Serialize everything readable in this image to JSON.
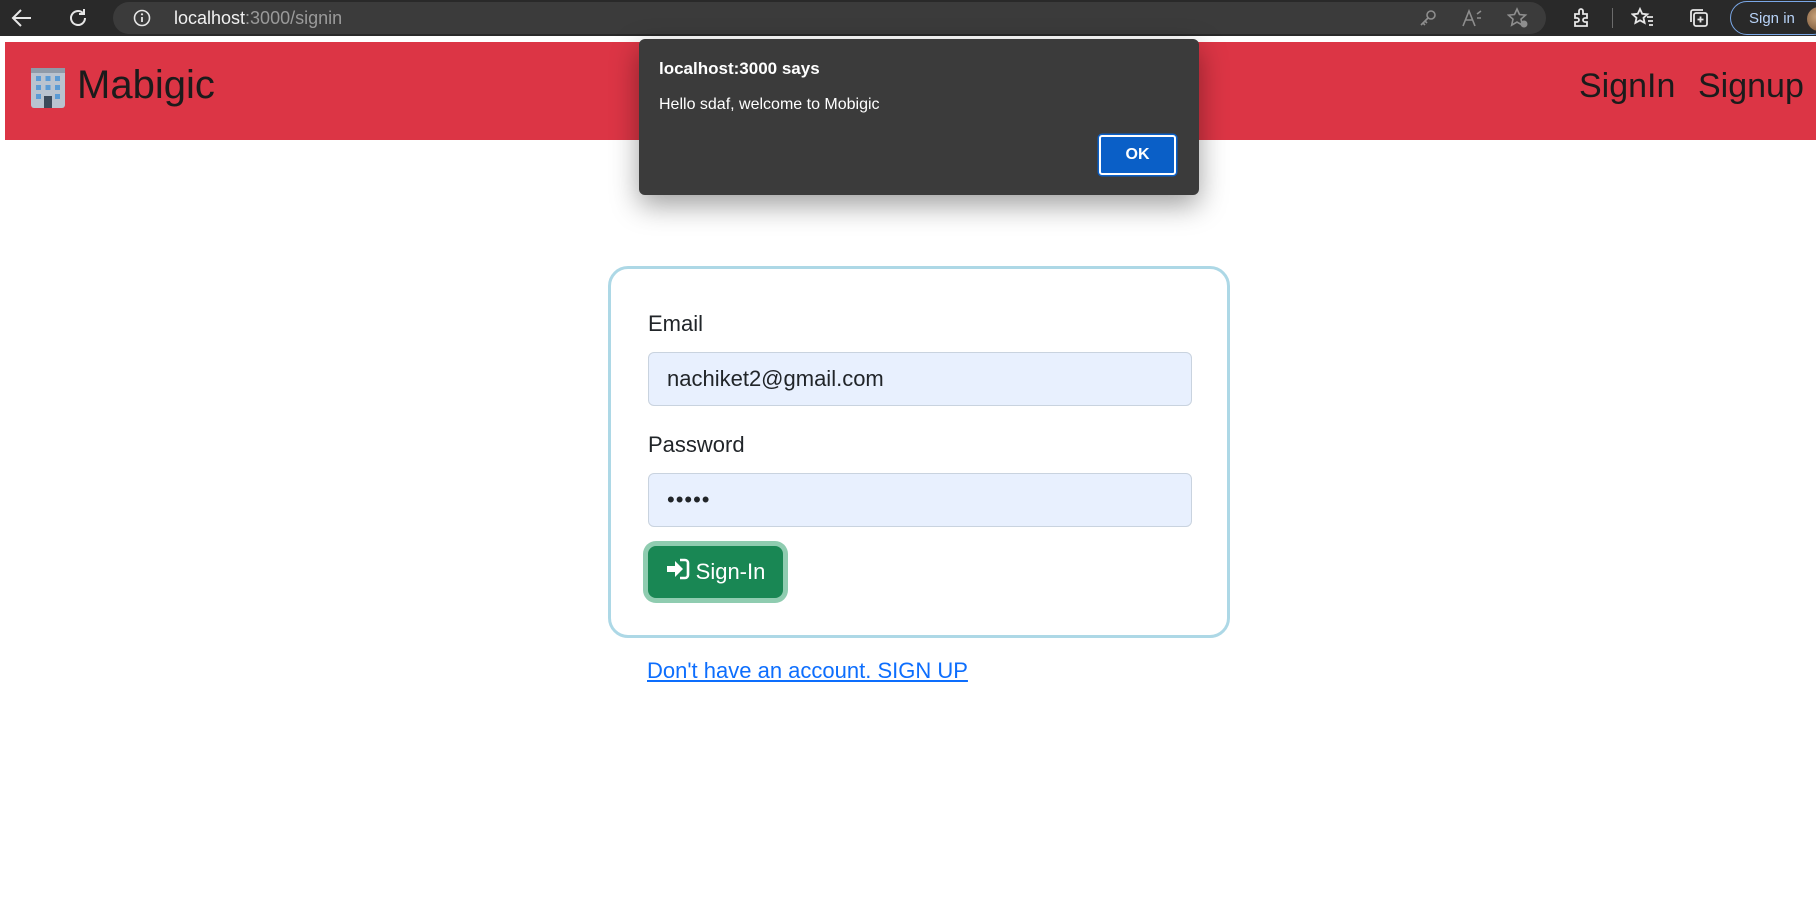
{
  "browser": {
    "url_host": "localhost",
    "url_path": ":3000/signin",
    "profile_label": "Sign in"
  },
  "navbar": {
    "brand": "Mabigic",
    "links": [
      "SignIn",
      "Signup"
    ],
    "background": "#dc3545"
  },
  "alert": {
    "title": "localhost:3000 says",
    "message": "Hello sdaf, welcome to Mobigic",
    "ok_label": "OK"
  },
  "form": {
    "email_label": "Email",
    "email_value": "nachiket2@gmail.com",
    "password_label": "Password",
    "password_value": "•••••",
    "submit_label": "Sign-In",
    "submit_icon": "sign-in-arrow-icon"
  },
  "signup_link": "Don't have an account. SIGN UP",
  "colors": {
    "accent": "#dc3545",
    "button": "#198754",
    "link": "#0d6efd",
    "card_border": "#add8e6",
    "input_bg": "#e8f0fe"
  }
}
